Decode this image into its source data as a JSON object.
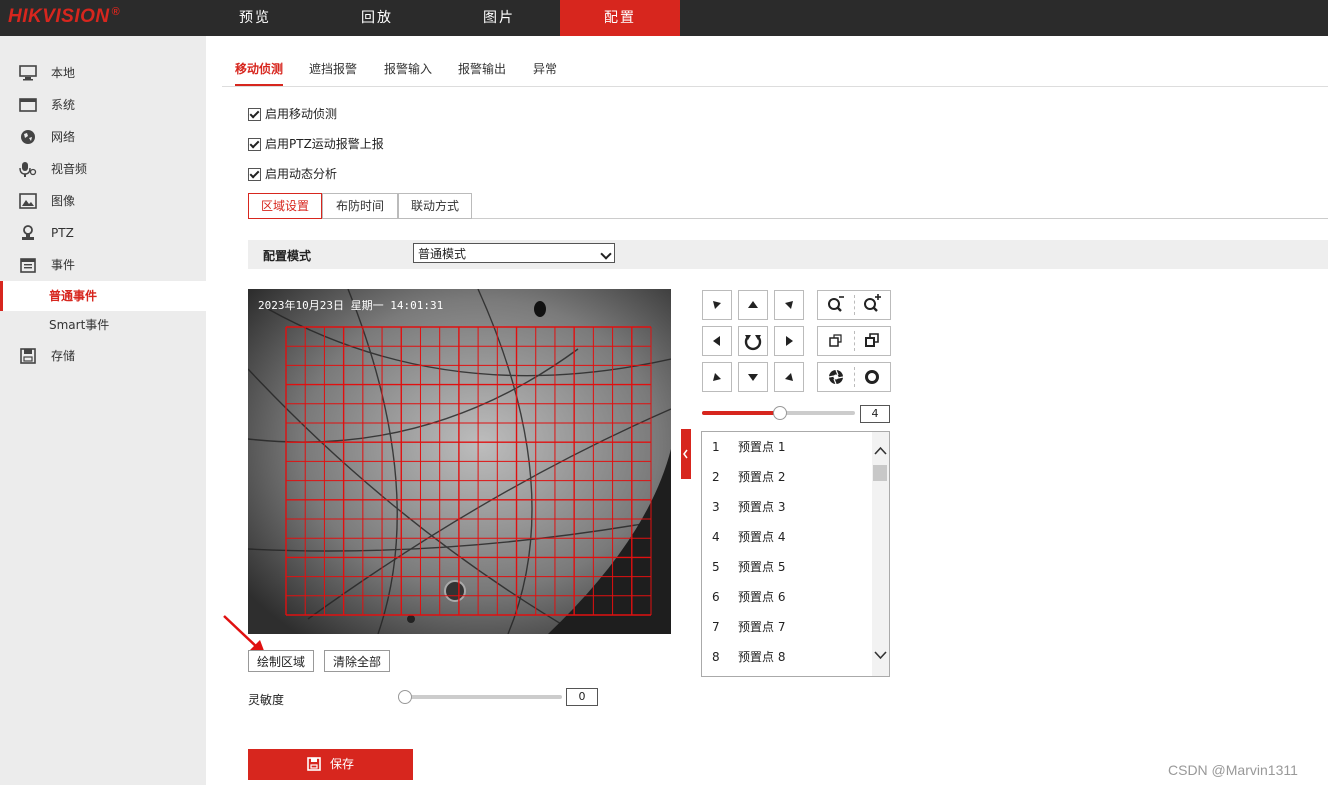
{
  "brand": {
    "logo": "HIKVISION",
    "reg": "®"
  },
  "top_nav": [
    {
      "label": "预览"
    },
    {
      "label": "回放"
    },
    {
      "label": "图片"
    },
    {
      "label": "配置",
      "active": true
    }
  ],
  "sidebar": {
    "items": [
      {
        "label": "本地",
        "icon": "monitor-icon"
      },
      {
        "label": "系统",
        "icon": "window-icon"
      },
      {
        "label": "网络",
        "icon": "globe-icon"
      },
      {
        "label": "视音频",
        "icon": "microphone-icon"
      },
      {
        "label": "图像",
        "icon": "image-icon"
      },
      {
        "label": "PTZ",
        "icon": "ptz-icon"
      },
      {
        "label": "事件",
        "icon": "calendar-icon"
      },
      {
        "label": "普通事件",
        "sub": true,
        "active": true
      },
      {
        "label": "Smart事件",
        "sub": true
      },
      {
        "label": "存储",
        "icon": "disk-icon"
      }
    ]
  },
  "tabs": [
    {
      "label": "移动侦测",
      "active": true
    },
    {
      "label": "遮挡报警"
    },
    {
      "label": "报警输入"
    },
    {
      "label": "报警输出"
    },
    {
      "label": "异常"
    }
  ],
  "checkboxes": [
    {
      "label": "启用移动侦测",
      "checked": true
    },
    {
      "label": "启用PTZ运动报警上报",
      "checked": true
    },
    {
      "label": "启用动态分析",
      "checked": true
    }
  ],
  "subtabs": [
    {
      "label": "区域设置",
      "active": true
    },
    {
      "label": "布防时间"
    },
    {
      "label": "联动方式"
    }
  ],
  "config_mode": {
    "label": "配置模式",
    "value": "普通模式"
  },
  "video": {
    "osd": "2023年10月23日  星期一  14:01:31"
  },
  "draw_area_button": "绘制区域",
  "clear_all_button": "清除全部",
  "sensitivity": {
    "label": "灵敏度",
    "value": "0",
    "level": 0
  },
  "ptz_speed": {
    "value": "4",
    "level": 0.5
  },
  "presets": [
    {
      "num": "1",
      "label": "预置点 1"
    },
    {
      "num": "2",
      "label": "预置点 2"
    },
    {
      "num": "3",
      "label": "预置点 3"
    },
    {
      "num": "4",
      "label": "预置点 4"
    },
    {
      "num": "5",
      "label": "预置点 5"
    },
    {
      "num": "6",
      "label": "预置点 6"
    },
    {
      "num": "7",
      "label": "预置点 7"
    },
    {
      "num": "8",
      "label": "预置点 8"
    }
  ],
  "save_button": "保存",
  "watermark": "CSDN @Marvin1311",
  "colors": {
    "accent": "#d7261e",
    "topbar": "#2b2b2b",
    "sidebar": "#ececec",
    "grid": "#e01010"
  }
}
